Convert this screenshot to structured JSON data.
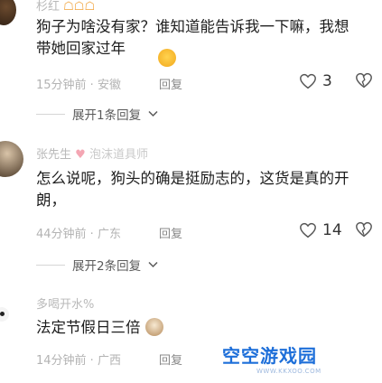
{
  "comments": [
    {
      "user": "杉红",
      "text": "狗子为啥没有家？谁知道能告诉我一下嘛，我想带她回家过年",
      "time": "15分钟前",
      "location": "安徽",
      "reply_label": "回复",
      "likes": "3",
      "expand": "展开1条回复"
    },
    {
      "user": "张先生",
      "user_tag": "泡沫道具师",
      "text": "怎么说呢，狗头的确是挺励志的，这货是真的开朗，",
      "time": "44分钟前",
      "location": "广东",
      "reply_label": "回复",
      "likes": "14",
      "expand": "展开2条回复"
    },
    {
      "user": "多喝开水%",
      "text": "法定节假日三倍",
      "time": "14分钟前",
      "location": "广西",
      "reply_label": "回复"
    }
  ],
  "watermark": {
    "title": "空空游戏园",
    "url": "WWW.KKXOO.COM"
  },
  "icons": {
    "like": "heart-outline-icon",
    "dislike": "heart-dislike-icon",
    "expand": "chevron-down-icon"
  },
  "colors": {
    "meta": "#b3b3b3",
    "watermark": "#1e6fd9"
  }
}
